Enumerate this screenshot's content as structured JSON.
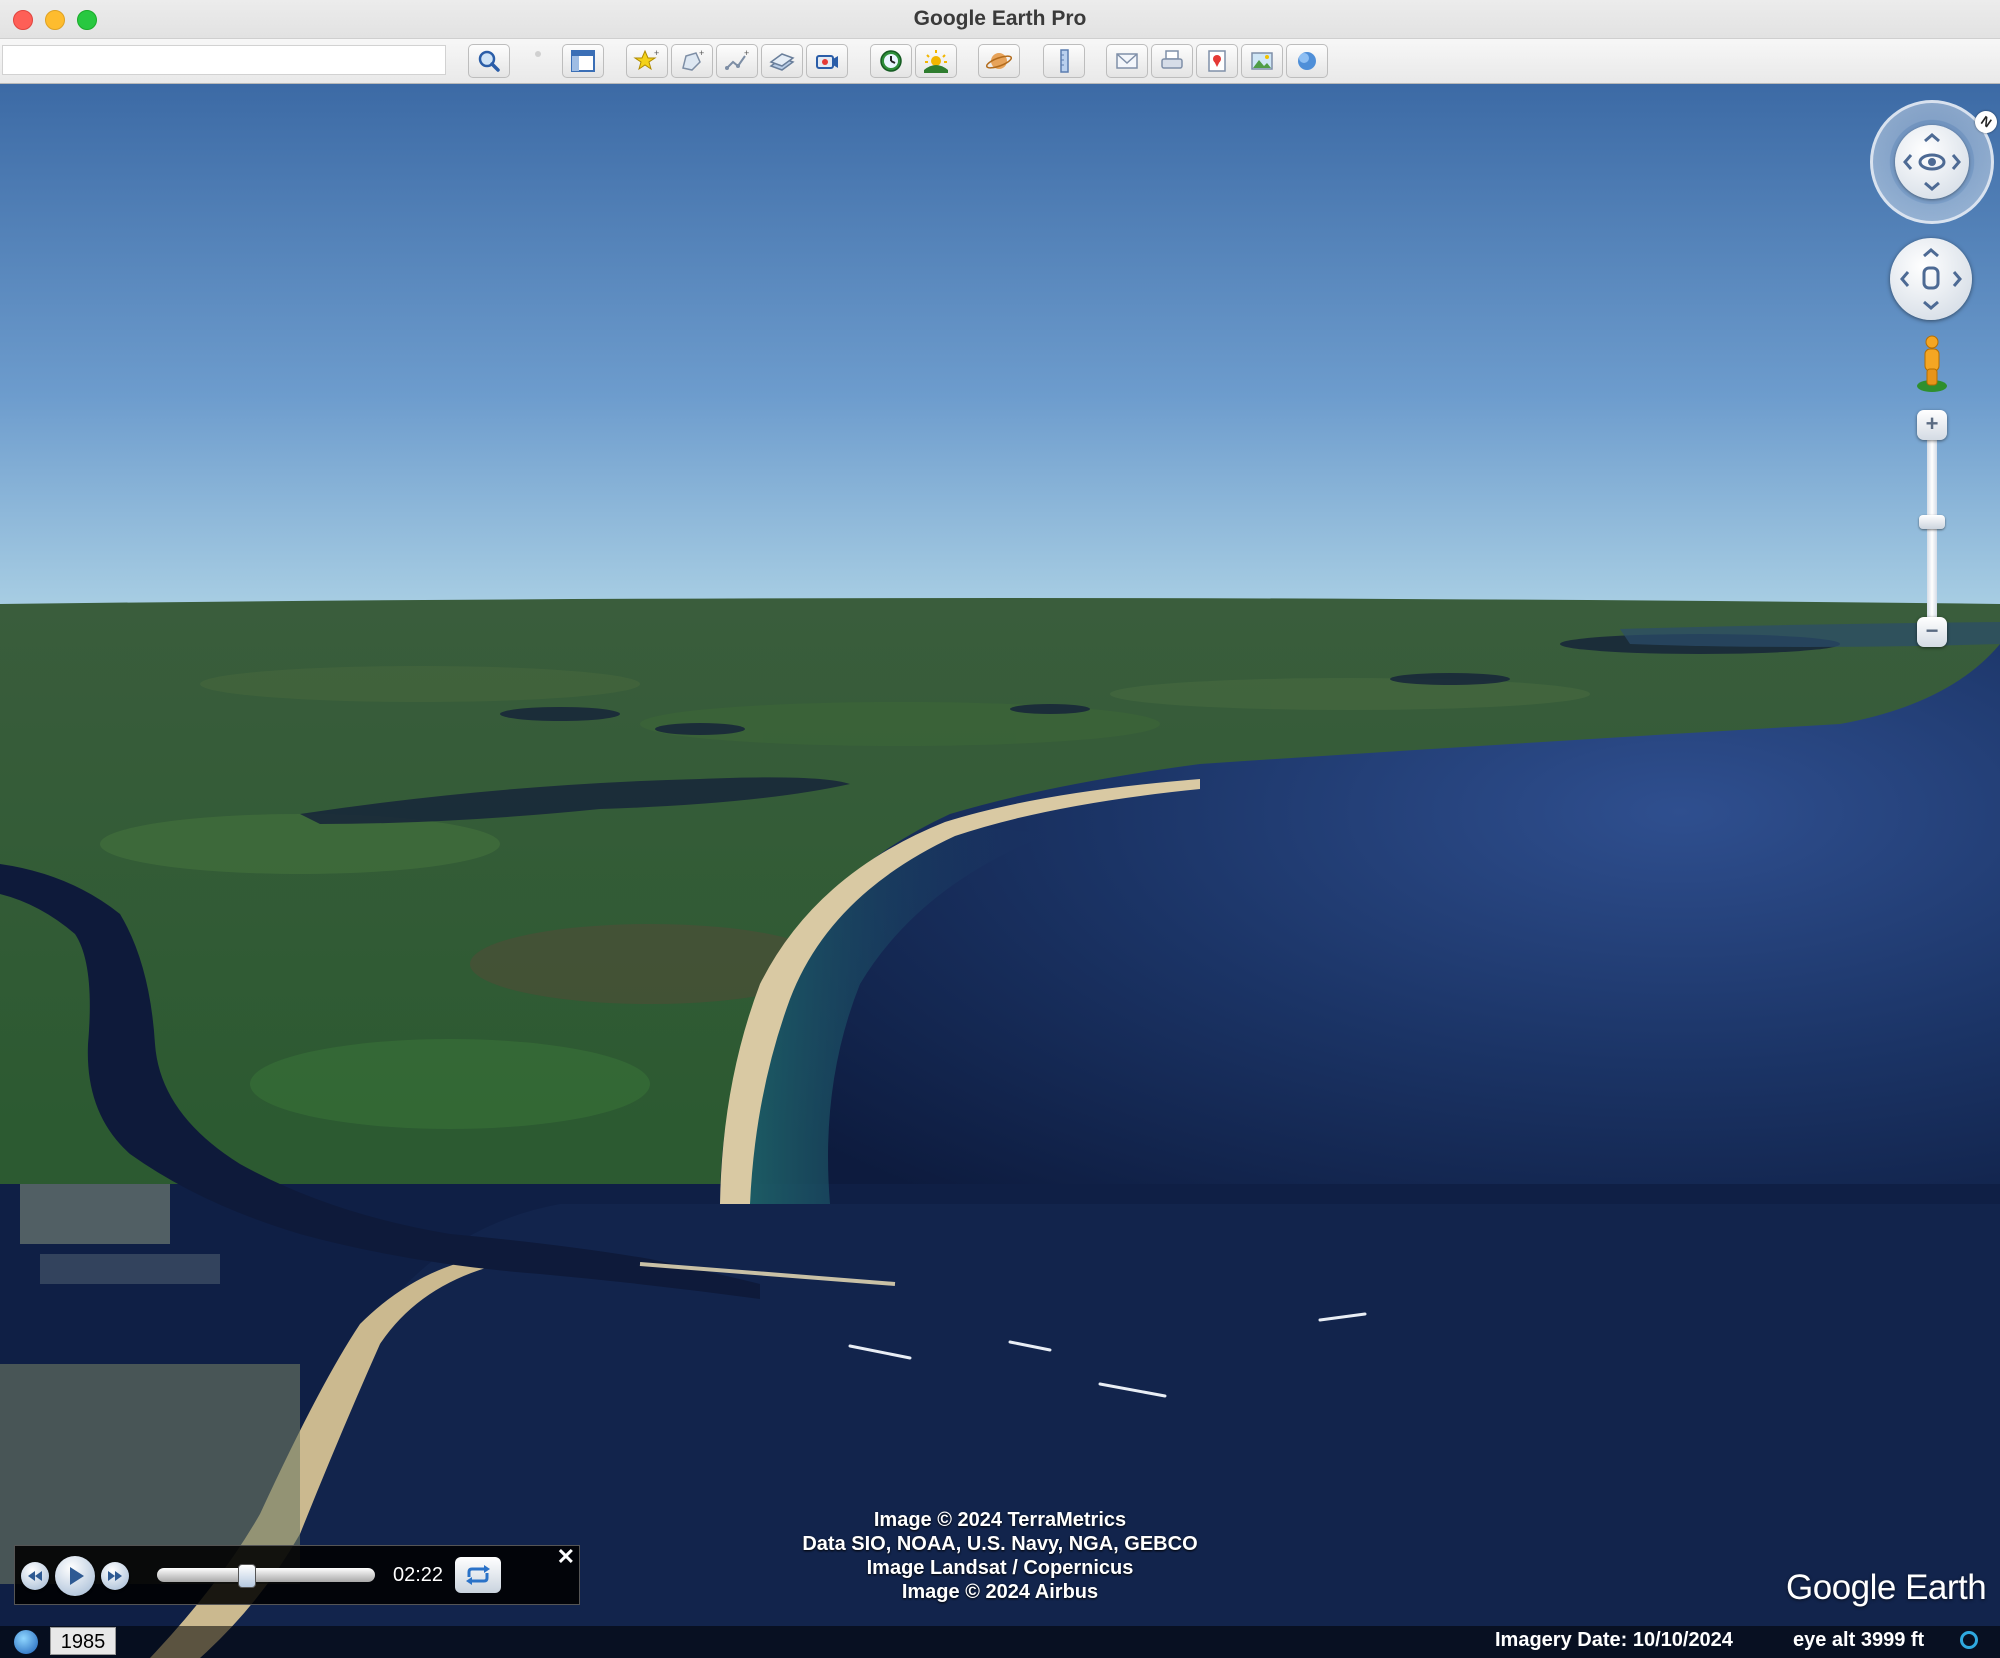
{
  "window": {
    "title": "Google Earth Pro"
  },
  "toolbar": {
    "search_value": "",
    "buttons": [
      {
        "name": "search-button",
        "icon": "magnifier-icon"
      },
      {
        "name": "sidebar-toggle-button",
        "icon": "sidebar-icon"
      },
      {
        "name": "add-placemark-button",
        "icon": "pushpin-icon"
      },
      {
        "name": "add-polygon-button",
        "icon": "polygon-icon"
      },
      {
        "name": "add-path-button",
        "icon": "path-icon"
      },
      {
        "name": "add-image-overlay-button",
        "icon": "overlay-icon"
      },
      {
        "name": "record-tour-button",
        "icon": "record-tour-icon"
      },
      {
        "name": "historical-imagery-button",
        "icon": "clock-icon"
      },
      {
        "name": "sunlight-button",
        "icon": "sun-icon"
      },
      {
        "name": "switch-planet-button",
        "icon": "planet-icon"
      },
      {
        "name": "ruler-button",
        "icon": "ruler-icon"
      },
      {
        "name": "email-button",
        "icon": "envelope-icon"
      },
      {
        "name": "print-button",
        "icon": "printer-icon"
      },
      {
        "name": "view-in-maps-button",
        "icon": "maps-icon"
      },
      {
        "name": "save-image-button",
        "icon": "save-image-icon"
      },
      {
        "name": "view-in-earth-button",
        "icon": "globe-icon"
      }
    ]
  },
  "navigation": {
    "north_label": "N",
    "zoom_in": "+",
    "zoom_out": "−"
  },
  "attribution": {
    "lines": [
      "Image © 2024 TerraMetrics",
      "Data SIO, NOAA, U.S. Navy, NGA, GEBCO",
      "Image Landsat / Copernicus",
      "Image © 2024 Airbus"
    ]
  },
  "logo": {
    "text": "Google Earth"
  },
  "time_slider": {
    "time": "02:22",
    "position_fraction": 0.4,
    "close_label": "✕"
  },
  "statusbar": {
    "year": "1985",
    "imagery_date": "Imagery Date: 10/10/2024",
    "eye_alt": "eye alt   3999 ft"
  },
  "colors": {
    "sky_top": "#3c6aa5",
    "sky_horizon": "#9dc4de",
    "land": "#2f5a32",
    "ocean": "#14264f",
    "river": "#0e1a3a",
    "beach": "#d9c9a3"
  }
}
